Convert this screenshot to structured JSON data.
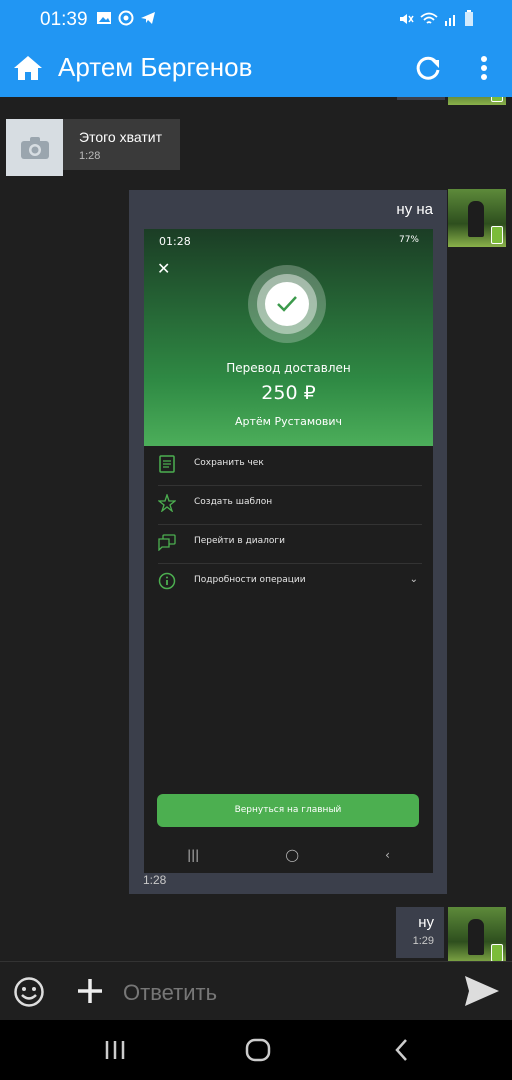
{
  "status_bar": {
    "time": "01:39"
  },
  "header": {
    "title": "Артем Бергенов"
  },
  "messages": [
    {
      "text": "Этого хватит",
      "time": "1:28"
    },
    {
      "caption": "ну на",
      "time": "1:28"
    },
    {
      "text": "ну",
      "time": "1:29"
    }
  ],
  "shot": {
    "time": "01:28",
    "battery": "77%",
    "status_title": "Перевод доставлен",
    "amount": "250 ₽",
    "recipient": "Артём Рустамович",
    "menu": [
      "Сохранить чек",
      "Создать шаблон",
      "Перейти в диалоги",
      "Подробности операции"
    ],
    "home_button": "Вернуться на главный"
  },
  "composer": {
    "placeholder": "Ответить"
  },
  "colors": {
    "accent": "#2196f3",
    "bubble_out": "#3b3f4b",
    "bubble_in": "#3a3a3a",
    "success": "#4caf50"
  },
  "icons": [
    "home-icon",
    "refresh-icon",
    "more-vert-icon",
    "camera-icon",
    "emoji-icon",
    "plus-icon",
    "send-icon"
  ]
}
